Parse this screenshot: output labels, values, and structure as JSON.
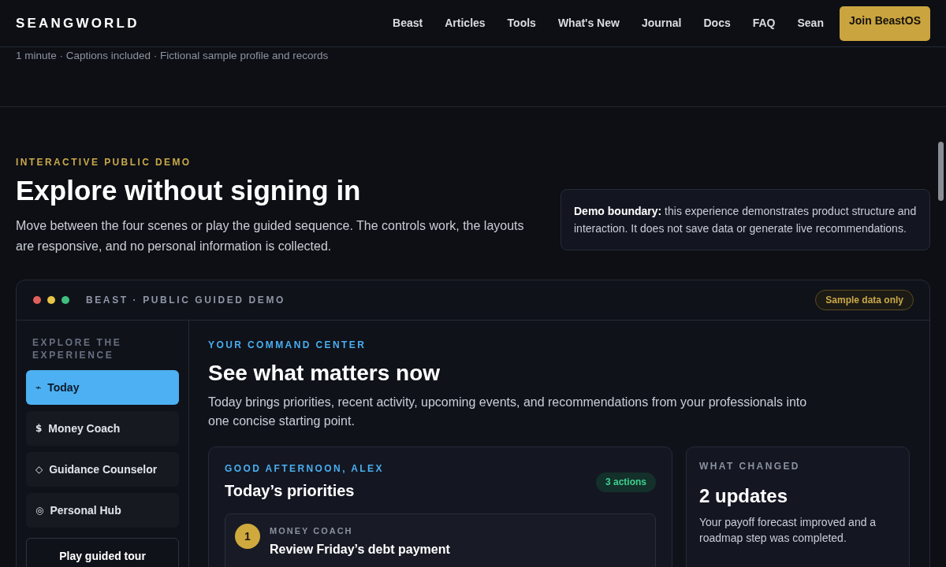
{
  "nav": {
    "brand": "SEANGWORLD",
    "links": [
      {
        "label": "Beast"
      },
      {
        "label": "Articles"
      },
      {
        "label": "Tools"
      },
      {
        "label": "What's New"
      },
      {
        "label": "Journal"
      },
      {
        "label": "Docs"
      },
      {
        "label": "FAQ"
      },
      {
        "label": "Sean"
      }
    ],
    "cta": "Join BeastOS"
  },
  "meta_line": "1 minute · Captions included · Fictional sample profile and records",
  "intro": {
    "eyebrow": "INTERACTIVE PUBLIC DEMO",
    "title": "Explore without signing in",
    "description": "Move between the four scenes or play the guided sequence. The controls work, the layouts are responsive, and no personal information is collected.",
    "notice": "**Demo boundary:** this experience demonstrates product structure and interaction. It does not save data or generate live recommendations."
  },
  "demo": {
    "title": "BEAST · PUBLIC GUIDED DEMO",
    "badge": "Sample data only",
    "sidebar": {
      "heading": "EXPLORE THE EXPERIENCE",
      "items": [
        {
          "glyph": "⌁",
          "label": "Today",
          "selected": true
        },
        {
          "glyph": "$",
          "label": "Money Coach",
          "selected": false
        },
        {
          "glyph": "◇",
          "label": "Guidance Counselor",
          "selected": false
        },
        {
          "glyph": "◎",
          "label": "Personal Hub",
          "selected": false
        }
      ],
      "tour_button": "Play guided tour"
    },
    "main": {
      "eyebrow": "YOUR COMMAND CENTER",
      "title": "See what matters now",
      "description": "Today brings priorities, recent activity, upcoming events, and recommendations from your professionals into one concise starting point.",
      "priorities": {
        "eyebrow": "GOOD AFTERNOON, ALEX",
        "title": "Today’s priorities",
        "badge": "3 actions",
        "items": [
          {
            "number": "1",
            "category": "MONEY COACH",
            "title": "Review Friday’s debt payment"
          }
        ]
      },
      "changes": {
        "eyebrow": "WHAT CHANGED",
        "title": "2 updates",
        "text": "Your payoff forecast improved and a roadmap step was completed."
      }
    }
  }
}
